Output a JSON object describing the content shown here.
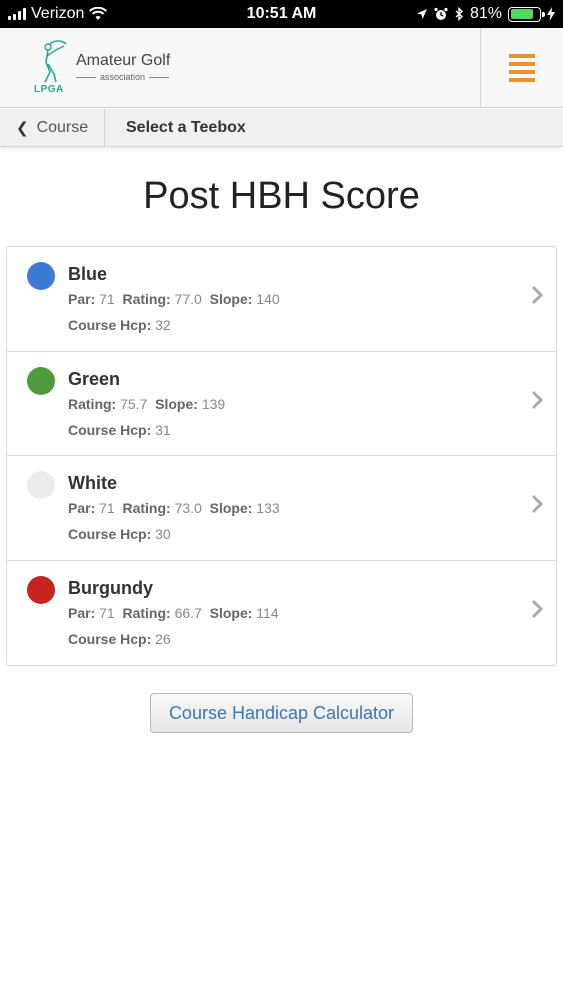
{
  "status_bar": {
    "carrier": "Verizon",
    "time": "10:51 AM",
    "battery_percent": "81%",
    "battery_level": 0.81,
    "icons": [
      "signal-icon",
      "wifi-icon",
      "location-icon",
      "alarm-icon",
      "bluetooth-icon",
      "battery-icon",
      "charging-icon"
    ]
  },
  "header": {
    "logo_main": "Amateur Golf",
    "logo_sub": "association",
    "logo_lpga": "LPGA",
    "menu_icon": "hamburger-menu-icon",
    "accent_color": "#e8922e"
  },
  "breadcrumb": {
    "back_label": "Course",
    "current": "Select a Teebox"
  },
  "page": {
    "title": "Post HBH Score"
  },
  "labels": {
    "par": "Par:",
    "rating": "Rating:",
    "slope": "Slope:",
    "course_hcp": "Course Hcp:"
  },
  "teeboxes": [
    {
      "name": "Blue",
      "color": "#3a7bd5",
      "par": "71",
      "rating": "77.0",
      "slope": "140",
      "course_hcp": "32"
    },
    {
      "name": "Green",
      "color": "#4f9a3c",
      "rating": "75.7",
      "slope": "139",
      "course_hcp": "31"
    },
    {
      "name": "White",
      "color": "#ececec",
      "par": "71",
      "rating": "73.0",
      "slope": "133",
      "course_hcp": "30"
    },
    {
      "name": "Burgundy",
      "color": "#c8231e",
      "par": "71",
      "rating": "66.7",
      "slope": "114",
      "course_hcp": "26"
    }
  ],
  "actions": {
    "calculator_label": "Course Handicap Calculator",
    "link_color": "#3a78b8"
  }
}
